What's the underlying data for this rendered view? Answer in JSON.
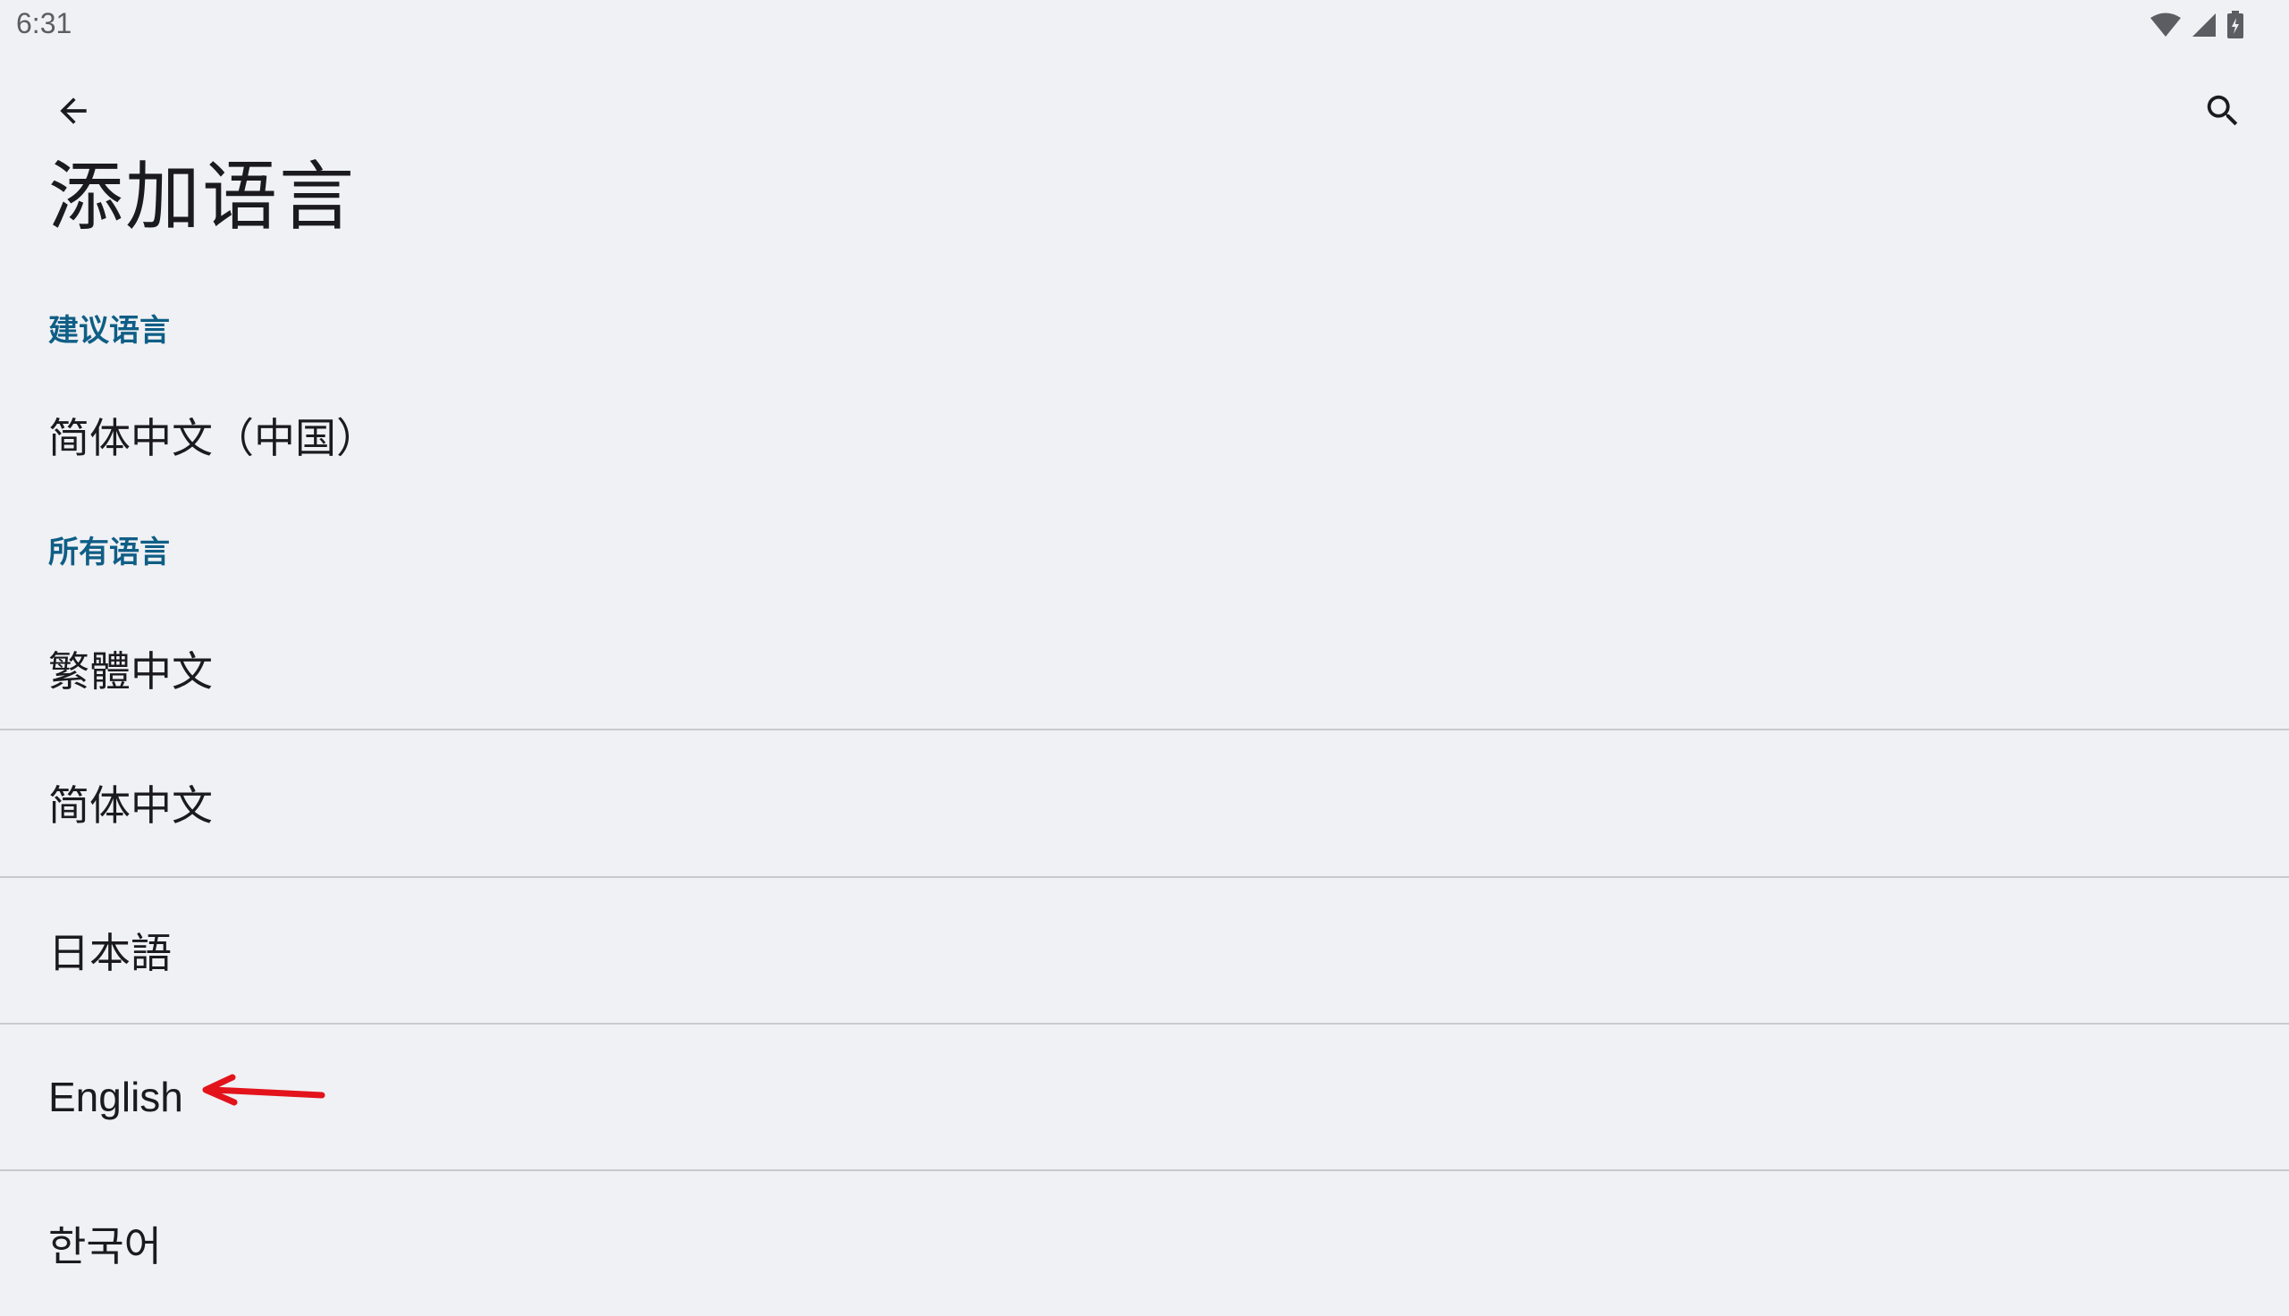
{
  "status_bar": {
    "time": "6:31",
    "icons": [
      "wifi-icon",
      "cell-signal-icon",
      "battery-charging-icon"
    ]
  },
  "toolbar": {
    "back_icon": "arrow-left",
    "search_icon": "magnifier"
  },
  "page": {
    "title": "添加语言"
  },
  "sections": {
    "suggested": {
      "header": "建议语言",
      "items": [
        "简体中文（中国）"
      ]
    },
    "all": {
      "header": "所有语言",
      "items": [
        "繁體中文",
        "简体中文",
        "日本語",
        "English",
        "한국어"
      ]
    }
  },
  "colors": {
    "background": "#f0f1f4",
    "section_header": "#0f5e86",
    "divider": "#c8c9cd",
    "annotation_arrow": "#e3131b"
  }
}
